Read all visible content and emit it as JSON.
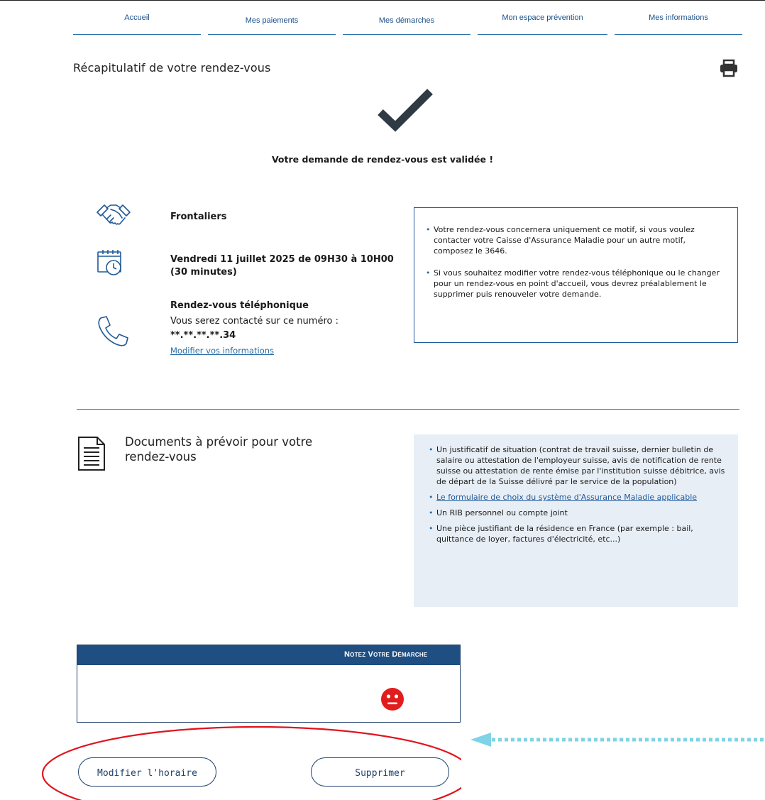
{
  "nav": {
    "items": [
      {
        "label": "Accueil"
      },
      {
        "label": "Mes paiements"
      },
      {
        "label": "Mes démarches"
      },
      {
        "label": "Mon espace prévention"
      },
      {
        "label": "Mes informations"
      }
    ]
  },
  "page": {
    "title": "Récapitulatif de votre rendez-vous",
    "confirmation": "Votre demande de rendez-vous est validée !"
  },
  "appointment": {
    "motif": "Frontaliers",
    "datetime": "Vendredi 11 juillet 2025 de 09H30 à 10H00 (30 minutes)",
    "type_title": "Rendez-vous téléphonique",
    "contact_text": "Vous serez contacté sur ce numéro :",
    "phone_masked": "**.**.**.**.34",
    "modify_link": "Modifier vos informations"
  },
  "info_box": {
    "items": [
      "Votre rendez-vous concernera uniquement ce motif, si vous voulez contacter votre Caisse d'Assurance Maladie pour un autre motif, composez le 3646.",
      "Si vous souhaitez modifier votre rendez-vous téléphonique ou le changer pour un rendez-vous en point d'accueil, vous devrez préalablement le supprimer puis renouveler votre demande."
    ]
  },
  "documents": {
    "title": "Documents à prévoir pour votre rendez-vous",
    "items": [
      "Un justificatif de situation (contrat de travail suisse, dernier bulletin de salaire ou attestation de l'employeur suisse, avis de notification de rente suisse ou attestation de rente émise par l'institution suisse débitrice, avis de départ de la Suisse délivré par le service de la population)",
      "Le formulaire de choix du système d'Assurance Maladie applicable",
      "Un RIB personnel ou compte joint",
      "Une pièce justifiant de la résidence en France (par exemple : bail, quittance de loyer, factures d'électricité, etc...)"
    ]
  },
  "rating": {
    "title": "Notez votre démarche"
  },
  "actions": {
    "modify_schedule": "Modifier l'horaire",
    "delete": "Supprimer"
  },
  "colors": {
    "primary": "#1f4e82",
    "link": "#2a6ea6",
    "info_bg": "#e8eef6",
    "smiley": "#e11d1d",
    "annotation_ellipse": "#e0141e",
    "annotation_arrow": "#7fd3e6"
  },
  "icons": [
    "print-icon",
    "check-icon",
    "handshake-icon",
    "calendar-clock-icon",
    "phone-icon",
    "document-icon",
    "neutral-face-icon"
  ]
}
